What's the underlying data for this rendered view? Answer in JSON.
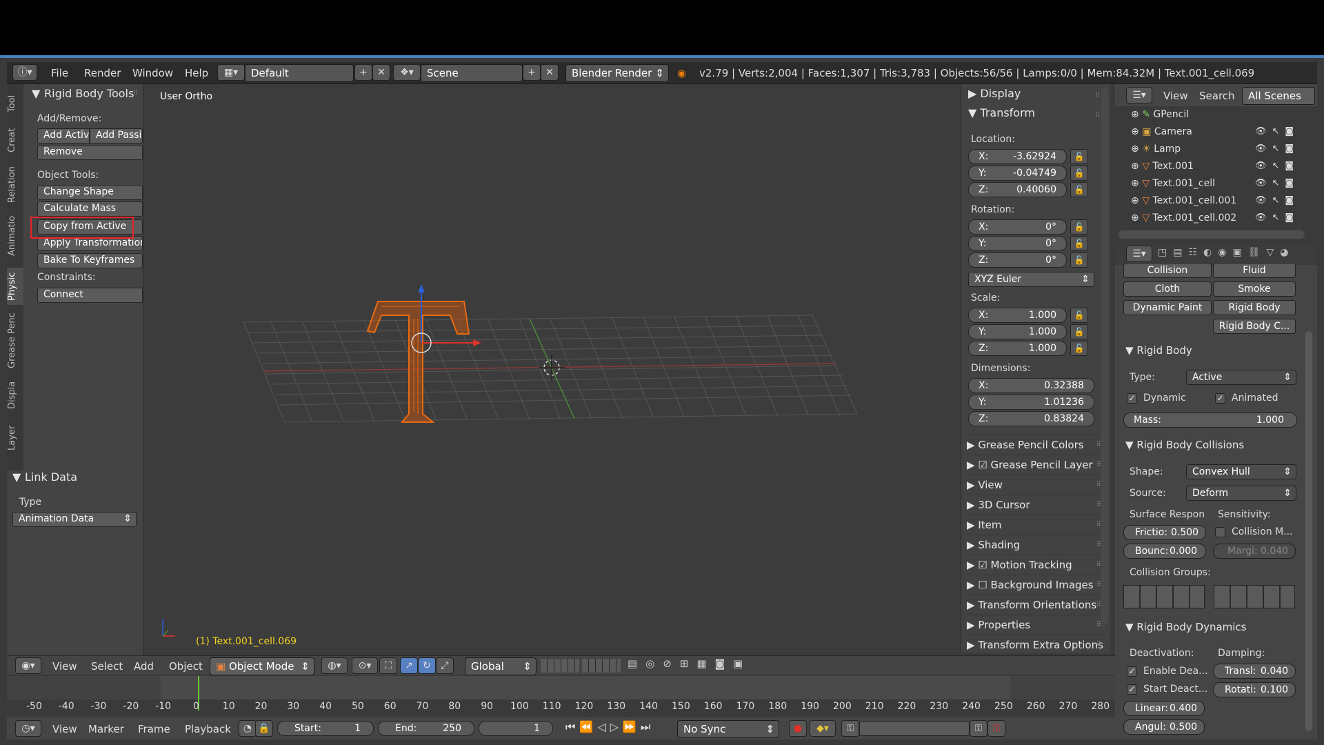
{
  "topbar": {
    "menus": [
      "File",
      "Render",
      "Window",
      "Help"
    ],
    "layout": "Default",
    "scene": "Scene",
    "engine": "Blender Render",
    "stats": "v2.79 | Verts:2,004 | Faces:1,307 | Tris:3,783 | Objects:56/56 | Lamps:0/0 | Mem:84.32M | Text.001_cell.069"
  },
  "toolshelf": {
    "tabs": [
      "Tool",
      "Creat",
      "Relation",
      "Animatio",
      "Physic",
      "Grease Penc",
      "Displa",
      "Layer"
    ],
    "active_tab": "Physic",
    "panel_title": "Rigid Body Tools",
    "add_remove_label": "Add/Remove:",
    "add_active": "Add Activ",
    "add_passive": "Add Passi",
    "remove": "Remove",
    "object_tools_label": "Object Tools:",
    "change_shape": "Change Shape",
    "calculate_mass": "Calculate Mass",
    "copy_from_active": "Copy from Active",
    "apply_transformation": "Apply Transformation",
    "bake_to_keyframes": "Bake To Keyframes",
    "constraints_label": "Constraints:",
    "connect": "Connect",
    "link_data_title": "Link Data",
    "type_label": "Type",
    "type_value": "Animation Data",
    "highlight_color": "#e8232a"
  },
  "viewport": {
    "view_label": "User Ortho",
    "object_label": "(1) Text.001_cell.069"
  },
  "npanel": {
    "display": "Display",
    "transform": "Transform",
    "location_label": "Location:",
    "location": [
      {
        "axis": "X:",
        "value": "-3.62924"
      },
      {
        "axis": "Y:",
        "value": "-0.04749"
      },
      {
        "axis": "Z:",
        "value": "0.40060"
      }
    ],
    "rotation_label": "Rotation:",
    "rotation": [
      {
        "axis": "X:",
        "value": "0°"
      },
      {
        "axis": "Y:",
        "value": "0°"
      },
      {
        "axis": "Z:",
        "value": "0°"
      }
    ],
    "rotation_mode": "XYZ Euler",
    "scale_label": "Scale:",
    "scale": [
      {
        "axis": "X:",
        "value": "1.000"
      },
      {
        "axis": "Y:",
        "value": "1.000"
      },
      {
        "axis": "Z:",
        "value": "1.000"
      }
    ],
    "dimensions_label": "Dimensions:",
    "dimensions": [
      {
        "axis": "X:",
        "value": "0.32388"
      },
      {
        "axis": "Y:",
        "value": "1.01236"
      },
      {
        "axis": "Z:",
        "value": "0.83824"
      }
    ],
    "sections": [
      "Grease Pencil Colors",
      "Grease Pencil Layer",
      "View",
      "3D Cursor",
      "Item",
      "Shading",
      "Motion Tracking",
      "Background Images",
      "Transform Orientations",
      "Properties",
      "Transform Extra Options"
    ]
  },
  "outliner": {
    "view": "View",
    "search": "Search",
    "filter": "All Scenes",
    "items": [
      "GPencil",
      "Camera",
      "Lamp",
      "Text.001",
      "Text.001_cell",
      "Text.001_cell.001",
      "Text.001_cell.002"
    ]
  },
  "properties": {
    "physics_buttons": [
      "Collision",
      "Fluid",
      "Cloth",
      "Smoke",
      "Dynamic Paint",
      "Rigid Body",
      "Rigid Body C..."
    ],
    "rigid_body_title": "Rigid Body",
    "type_label": "Type:",
    "type_value": "Active",
    "dynamic": "Dynamic",
    "animated": "Animated",
    "mass_label": "Mass:",
    "mass_value": "1.000",
    "collisions_title": "Rigid Body Collisions",
    "shape_label": "Shape:",
    "shape_value": "Convex Hull",
    "source_label": "Source:",
    "source_value": "Deform",
    "surface_response": "Surface Respon",
    "sensitivity": "Sensitivity:",
    "friction": "Frictio:",
    "friction_value": "0.500",
    "bounce": "Bounc:",
    "bounce_value": "0.000",
    "collision_margin": "Collision M...",
    "margin": "Margi:",
    "margin_value": "0.040",
    "collision_groups": "Collision Groups:",
    "dynamics_title": "Rigid Body Dynamics",
    "deactivation": "Deactivation:",
    "damping": "Damping:",
    "enable_deactivation": "Enable Dea...",
    "start_deactivated": "Start Deact...",
    "translation": "Transl:",
    "translation_value": "0.040",
    "rotation": "Rotati:",
    "rotation_value": "0.100",
    "linear": "Linear:",
    "linear_value": "0.400",
    "angular": "Angul:",
    "angular_value": "0.500"
  },
  "viewport_header": {
    "menus": [
      "View",
      "Select",
      "Add",
      "Object"
    ],
    "mode": "Object Mode",
    "orientation": "Global"
  },
  "timeline": {
    "ticks": [
      "-50",
      "-40",
      "-30",
      "-20",
      "-10",
      "0",
      "10",
      "20",
      "30",
      "40",
      "50",
      "60",
      "70",
      "80",
      "90",
      "100",
      "110",
      "120",
      "130",
      "140",
      "150",
      "160",
      "170",
      "180",
      "190",
      "200",
      "210",
      "220",
      "230",
      "240",
      "250",
      "260",
      "270",
      "280"
    ],
    "menus": [
      "View",
      "Marker",
      "Frame",
      "Playback"
    ],
    "start_label": "Start:",
    "start_value": "1",
    "end_label": "End:",
    "end_value": "250",
    "current_frame": "1",
    "sync": "No Sync"
  }
}
